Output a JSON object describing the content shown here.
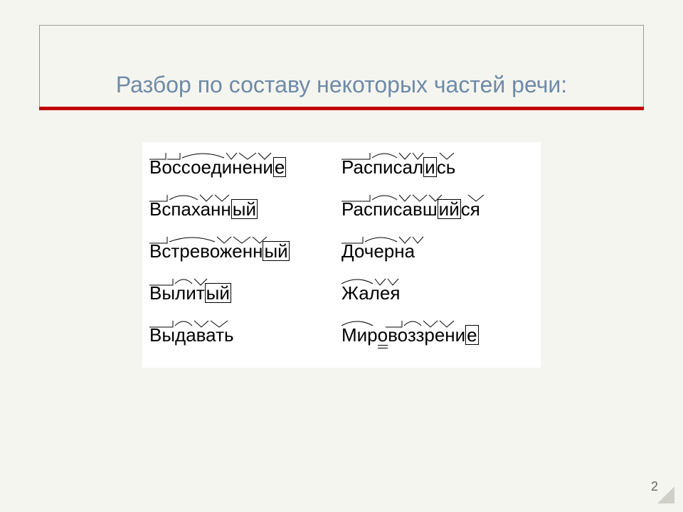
{
  "title": "Разбор по составу некоторых частей речи:",
  "page_number": "2",
  "words": {
    "r1c1": "Воссоединение",
    "r1c2": "Расписались",
    "r2c1": "Вспаханный",
    "r2c2": "Расписавшийся",
    "r3c1": "Встревоженный",
    "r3c2": "Дочерна",
    "r4c1": "Вылитый",
    "r4c2": "Жалея",
    "r5c1": "Выдавать",
    "r5c2": "Мировоззрение"
  },
  "colors": {
    "title_color": "#6d8aa8",
    "rule_color": "#c00000",
    "frame_color": "#999999",
    "bg": "#f5f5f0"
  }
}
